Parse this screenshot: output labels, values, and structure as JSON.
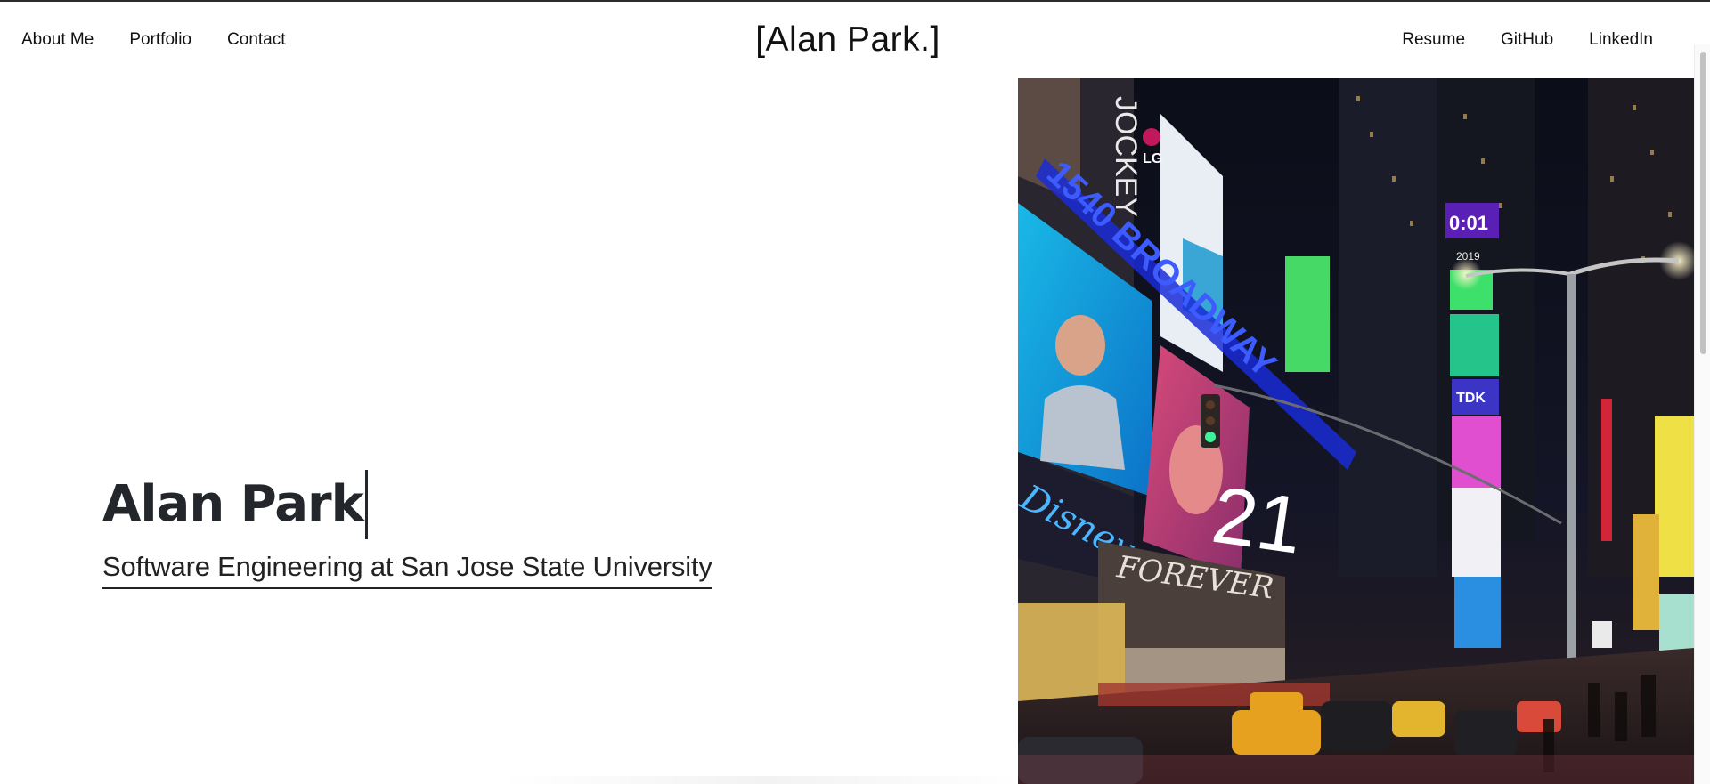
{
  "nav": {
    "left": [
      "About Me",
      "Portfolio",
      "Contact"
    ],
    "right": [
      "Resume",
      "GitHub",
      "LinkedIn"
    ]
  },
  "brand": "[Alan Park.]",
  "hero": {
    "name": "Alan Park",
    "subtitle": "Software Engineering at San Jose State University"
  },
  "photo": {
    "signs": {
      "lg": "LG",
      "jockey": "JOCKEY",
      "broadway": "1540 BROADWAY",
      "disney": "Disney",
      "forever": "FOREVER",
      "tdk": "TDK",
      "clock": "0:01",
      "year": "2019",
      "number": "21"
    }
  },
  "colors": {
    "text": "#111111",
    "heading": "#23262b",
    "background": "#ffffff"
  }
}
